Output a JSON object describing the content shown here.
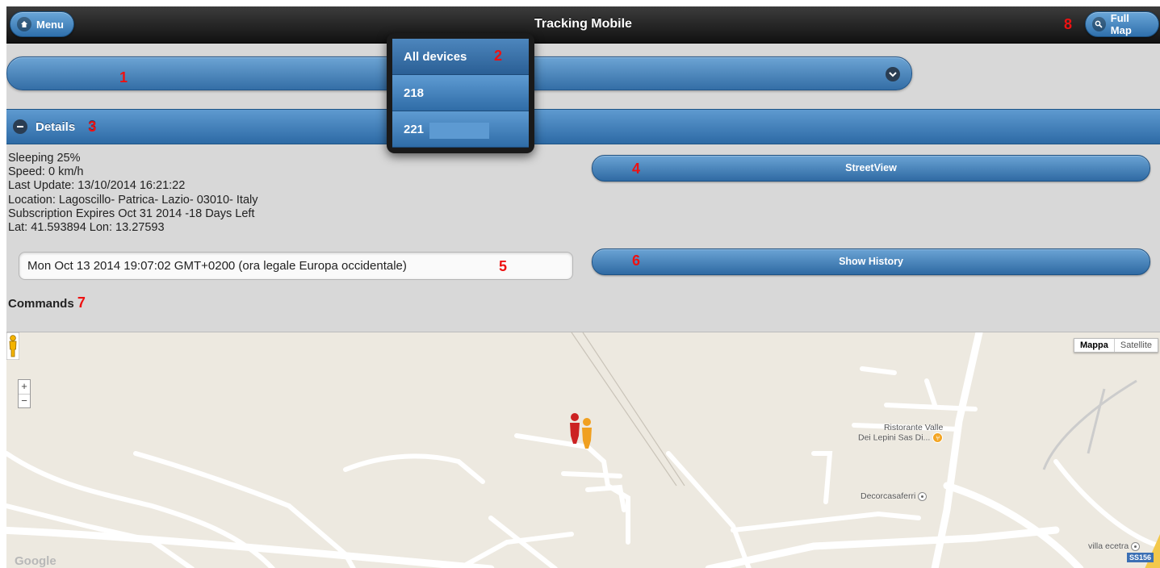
{
  "header": {
    "title": "Tracking Mobile",
    "menu_label": "Menu",
    "fullmap_label": "Full Map"
  },
  "markers": {
    "m1": "1",
    "m2": "2",
    "m3": "3",
    "m4": "4",
    "m5": "5",
    "m6": "6",
    "m7": "7",
    "m8": "8"
  },
  "device_select": {
    "options": [
      "All devices",
      "218",
      "221"
    ]
  },
  "details": {
    "header_label": "Details",
    "lines": [
      "Sleeping 25%",
      "Speed: 0 km/h",
      "Last Update: 13/10/2014 16:21:22",
      "Location: Lagoscillo- Patrica- Lazio- 03010- Italy",
      "Subscription Expires Oct 31 2014 -18 Days Left",
      "Lat: 41.593894 Lon: 13.27593"
    ],
    "date_value": "Mon Oct 13 2014 19:07:02 GMT+0200 (ora legale Europa occidentale)",
    "commands_label": "Commands",
    "streetview_label": "StreetView",
    "history_label": "Show History"
  },
  "map": {
    "type_map": "Mappa",
    "type_satellite": "Satellite",
    "zoom_in": "+",
    "zoom_out": "−",
    "poi_restaurant_line1": "Ristorante Valle",
    "poi_restaurant_line2": "Dei Lepini Sas Di...",
    "poi_decor": "Decorcasaferri",
    "poi_villa": "villa ecetra",
    "road_badge": "SS156",
    "attribution": "Google"
  },
  "colors": {
    "accent_blue": "#2f6ca7",
    "marker_red": "#e11111",
    "pin_red": "#cc2222",
    "pin_orange": "#f0a020"
  }
}
